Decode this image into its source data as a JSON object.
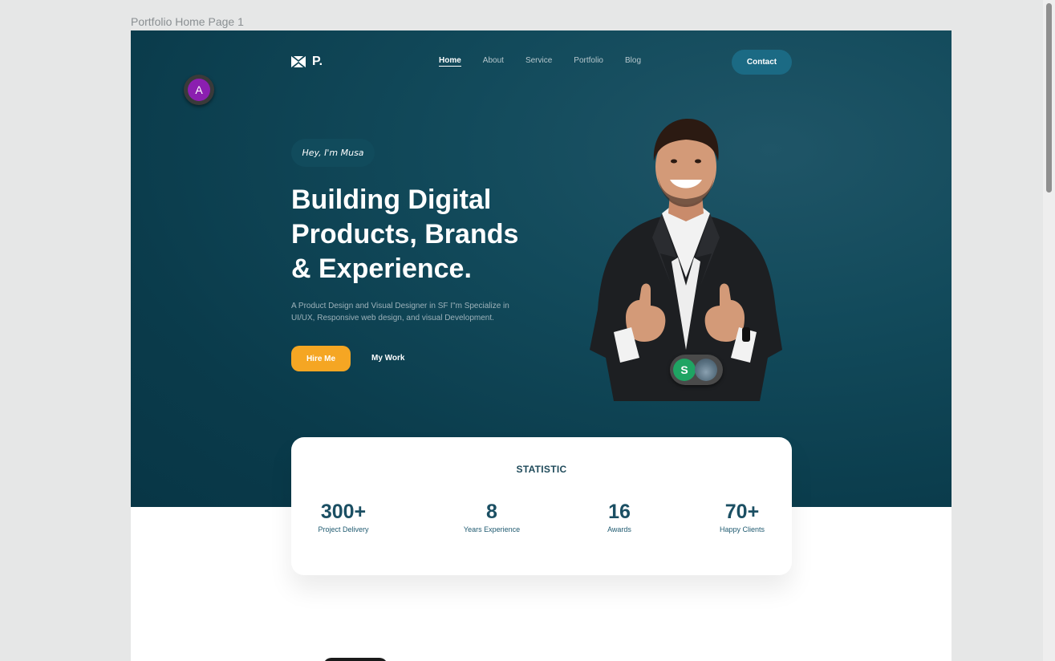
{
  "frame": {
    "label": "Portfolio Home Page 1"
  },
  "header": {
    "logo_text": "P.",
    "nav": [
      {
        "label": "Home",
        "active": true
      },
      {
        "label": "About",
        "active": false
      },
      {
        "label": "Service",
        "active": false
      },
      {
        "label": "Portfolio",
        "active": false
      },
      {
        "label": "Blog",
        "active": false
      }
    ],
    "contact_label": "Contact"
  },
  "collaborators": {
    "a_initial": "A",
    "s_initial": "S"
  },
  "hero": {
    "greeting": "Hey, I'm Musa",
    "headline": [
      "Building Digital",
      "Products, Brands",
      "& Experience."
    ],
    "subtext": "A Product Design and Visual Designer in SF I\"m Specialize in UI/UX, Responsive web design, and visual Development.",
    "hire_label": "Hire Me",
    "work_label": "My Work"
  },
  "statistic": {
    "title": "STATISTIC",
    "items": [
      {
        "value": "300+",
        "label": "Project Delivery"
      },
      {
        "value": "8",
        "label": "Years Experience"
      },
      {
        "value": "16",
        "label": "Awards"
      },
      {
        "value": "70+",
        "label": "Happy Clients"
      }
    ]
  },
  "colors": {
    "hero_bg": "#0a3b4b",
    "accent": "#f5a623",
    "contact_bg": "#1b6a84",
    "stat_text": "#1b4f63"
  }
}
